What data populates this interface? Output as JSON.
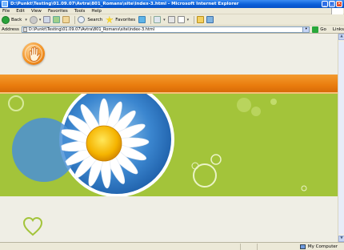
{
  "window": {
    "title": "D:\\Punkt\\Testing\\01.09.07\\Avtra\\801_Romans\\site\\index-3.html - Microsoft Internet Explorer",
    "minimize": "_",
    "maximize": "□",
    "close": "×"
  },
  "menu": [
    "File",
    "Edit",
    "View",
    "Favorites",
    "Tools",
    "Help"
  ],
  "toolbar": {
    "back": "Back",
    "search": "Search",
    "favorites": "Favorites"
  },
  "address": {
    "label": "Address",
    "url": "D:\\Punkt\\Testing\\01.09.07\\Avtra\\801_Romans\\site\\index-3.html",
    "go": "Go",
    "links": "Links"
  },
  "status": {
    "zone": "My Computer"
  },
  "colors": {
    "orange": "#ea7d0e",
    "green": "#a3c43a",
    "sky": "#2f7fd1"
  }
}
